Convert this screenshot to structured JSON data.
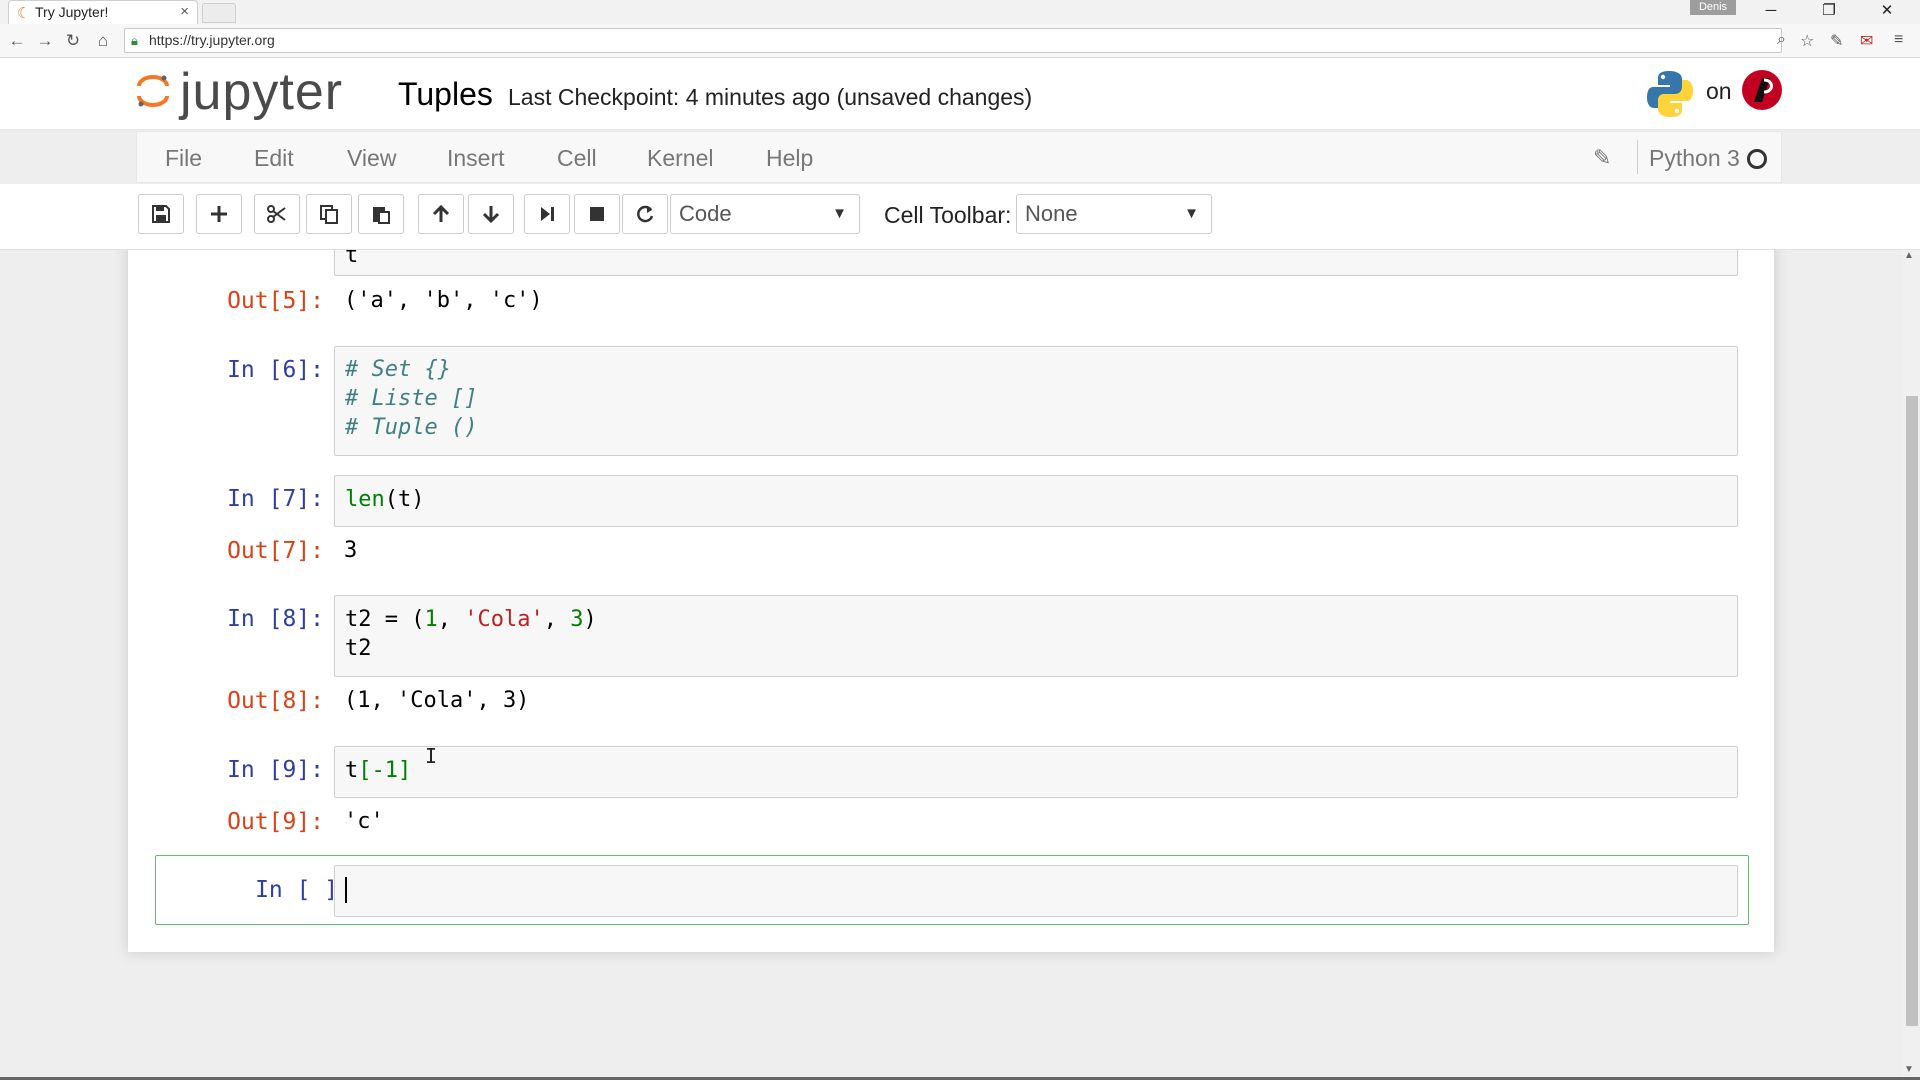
{
  "browser": {
    "tab_title": "Try Jupyter!",
    "tab_close": "×",
    "user_badge": "Denis",
    "url": "https://try.jupyter.org",
    "win_minimize": "─",
    "win_restore": "❐",
    "win_close": "✕"
  },
  "header": {
    "logo_text": "jupyter",
    "notebook_name": "Tuples",
    "checkpoint": "Last Checkpoint: 4 minutes ago (unsaved changes)",
    "on_text": "on"
  },
  "menubar": {
    "items": [
      "File",
      "Edit",
      "View",
      "Insert",
      "Cell",
      "Kernel",
      "Help"
    ],
    "kernel_name": "Python 3"
  },
  "toolbar": {
    "cell_type": "Code",
    "cell_toolbar_label": "Cell Toolbar:",
    "cell_toolbar_value": "None"
  },
  "cells": {
    "partial_input_line": "t",
    "out5": {
      "prompt": "Out[5]:",
      "text": "('a', 'b', 'c')"
    },
    "in6": {
      "prompt": "In [6]:",
      "lines": [
        "# Set {}",
        "# Liste []",
        "# Tuple ()"
      ]
    },
    "in7": {
      "prompt": "In [7]:",
      "fn": "len",
      "rest": "(t)"
    },
    "out7": {
      "prompt": "Out[7]:",
      "text": "3"
    },
    "in8": {
      "prompt": "In [8]:",
      "line1_a": "t2 = (",
      "line1_n1": "1",
      "line1_b": ", ",
      "line1_s": "'Cola'",
      "line1_c": ", ",
      "line1_n2": "3",
      "line1_d": ")",
      "line2": "t2"
    },
    "out8": {
      "prompt": "Out[8]:",
      "text": "(1, 'Cola', 3)"
    },
    "in9": {
      "prompt": "In [9]:",
      "name": "t",
      "open": "[",
      "idx": "-1",
      "close": "]"
    },
    "out9": {
      "prompt": "Out[9]:",
      "text": "'c'"
    },
    "in_empty": {
      "prompt": "In [ ]:"
    }
  }
}
